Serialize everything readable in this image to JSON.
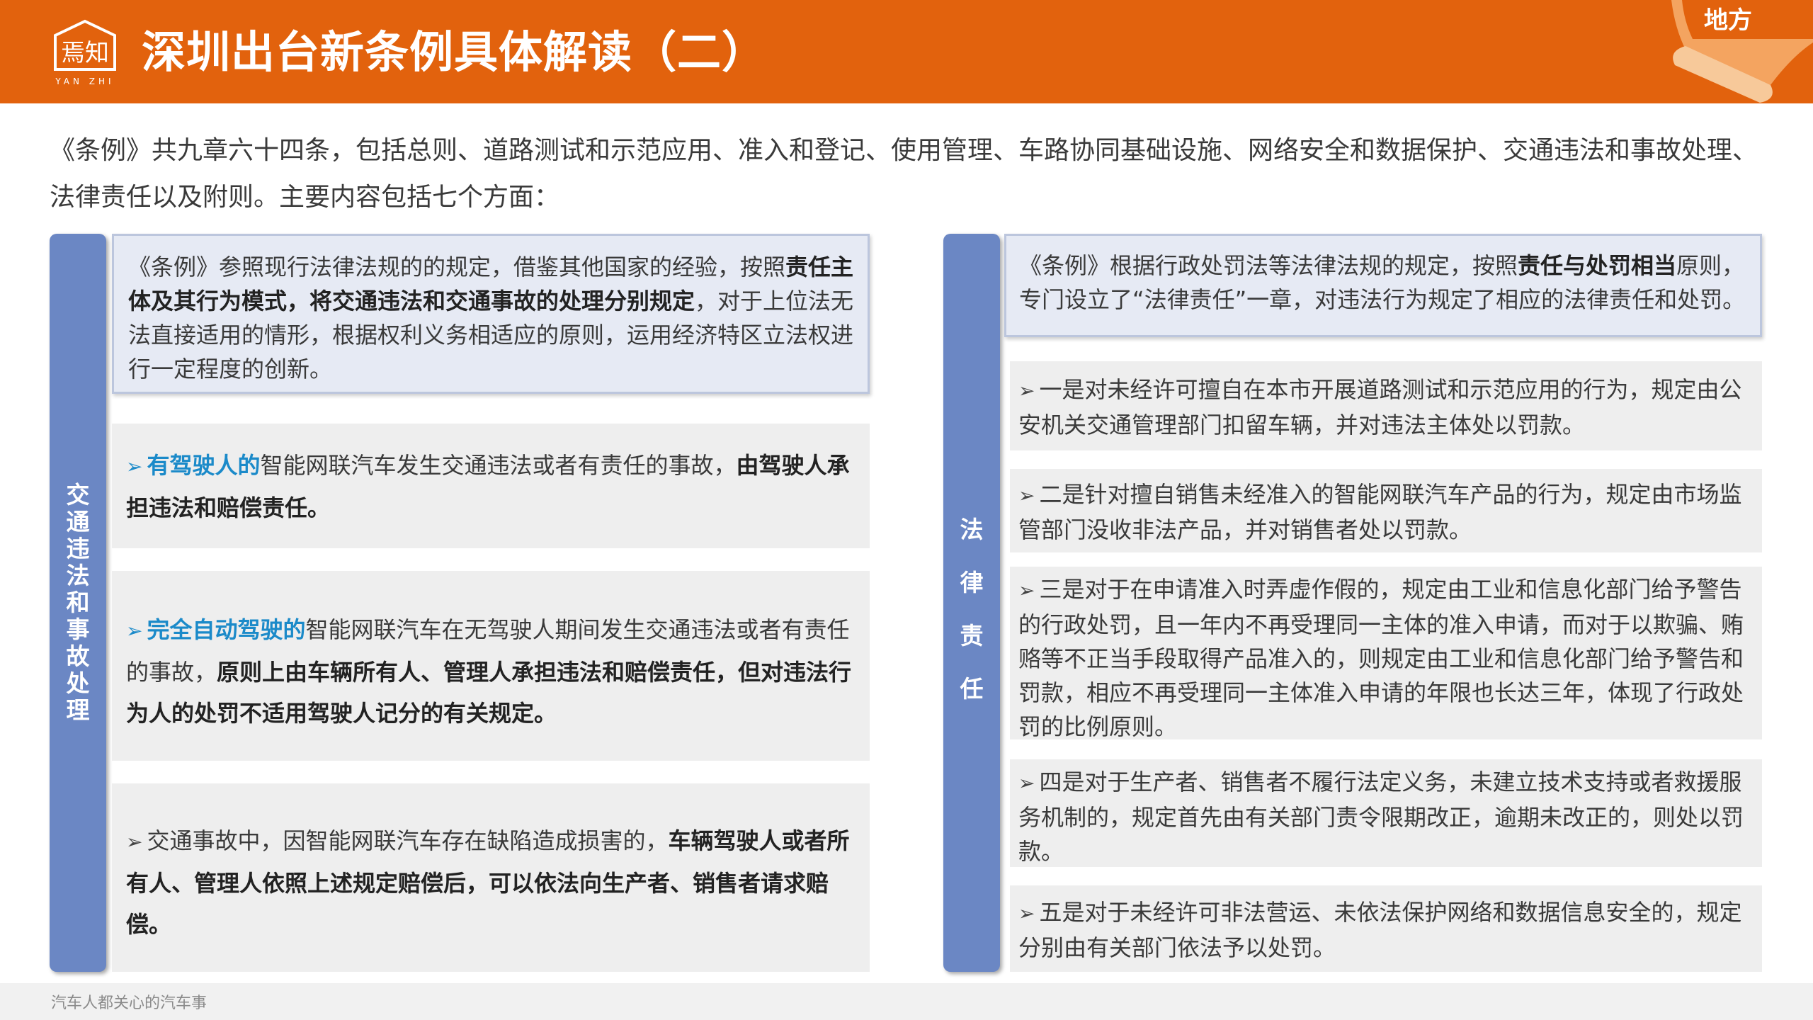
{
  "header": {
    "title": "深圳出台新条例具体解读（二）",
    "logo_text": "焉知",
    "logo_sub": "YAN ZHI",
    "region": "地方",
    "color": "#e2620d"
  },
  "intro": "《条例》共九章六十四条，包括总则、道路测试和示范应用、准入和登记、使用管理、车路协同基础设施、网络安全和数据保护、交通违法和事故处理、法律责任以及附则。主要内容包括七个方面：",
  "left": {
    "bar_label": "交通违法和事故处理",
    "summary": {
      "t1": "《条例》参照现行法律法规的的规定，借鉴其他国家的经验，按照",
      "b1": "责任主体及其行为模式，将交通违法和交通事故的处理分别规定",
      "t2": "，对于上位法无法直接适用的情形，根据权利义务相适应的原则，运用经济特区立法权进行一定程度的创新。"
    },
    "items": [
      {
        "hl": "有驾驶人的",
        "t1": "智能网联汽车发生交通违法或者有责任的事故，",
        "b1": "由驾驶人承担违法和赔偿责任。"
      },
      {
        "hl": "完全自动驾驶的",
        "t1": "智能网联汽车在无驾驶人期间发生交通违法或者有责任的事故，",
        "b1": "原则上由车辆所有人、管理人承担违法和赔偿责任，但对违法行为人的处罚不适用驾驶人记分的有关规定。"
      },
      {
        "t1": "交通事故中，因智能网联汽车存在缺陷造成损害的，",
        "b1": "车辆驾驶人或者所有人、管理人依照上述规定赔偿后，可以依法向生产者、销售者请求赔偿。"
      }
    ]
  },
  "right": {
    "bar_label": "法律责任",
    "summary": {
      "t1": "《条例》根据行政处罚法等法律法规的规定，按照",
      "b1": "责任与处罚相当",
      "t2": "原则，专门设立了“法律责任”一章，对违法行为规定了相应的法律责任和处罚。"
    },
    "items": [
      "一是对未经许可擅自在本市开展道路测试和示范应用的行为，规定由公安机关交通管理部门扣留车辆，并对违法主体处以罚款。",
      "二是针对擅自销售未经准入的智能网联汽车产品的行为，规定由市场监管部门没收非法产品，并对销售者处以罚款。",
      "三是对于在申请准入时弄虚作假的，规定由工业和信息化部门给予警告的行政处罚，且一年内不再受理同一主体的准入申请，而对于以欺骗、贿赂等不正当手段取得产品准入的，则规定由工业和信息化部门给予警告和罚款，相应不再受理同一主体准入申请的年限也长达三年，体现了行政处罚的比例原则。",
      "四是对于生产者、销售者不履行法定义务，未建立技术支持或者救援服务机制的，规定首先由有关部门责令限期改正，逾期未改正的，则处以罚款。",
      "五是对于未经许可非法营运、未依法保护网络和数据信息安全的，规定分别由有关部门依法予以处罚。"
    ]
  },
  "footer": "汽车人都关心的汽车事",
  "icons": {
    "bullet": "➢",
    "bullet_color_left": "#1b8ac9"
  }
}
